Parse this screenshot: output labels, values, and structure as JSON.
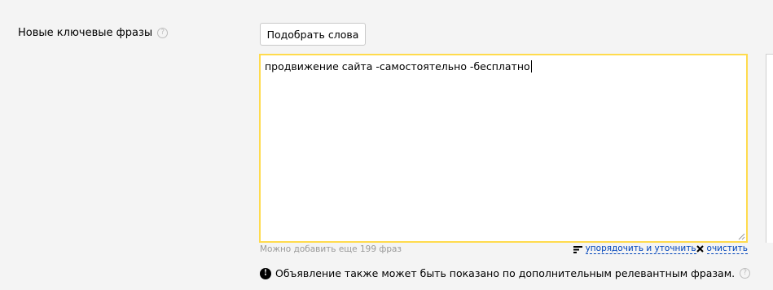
{
  "field": {
    "label": "Новые ключевые фразы",
    "help_glyph": "?"
  },
  "pick_button": {
    "label": "Подобрать слова"
  },
  "phrases": {
    "value": "продвижение сайта -самостоятельно -бесплатно"
  },
  "hint": {
    "remaining_text": "Можно добавить еще 199 фраз"
  },
  "actions": {
    "sort_label": "упорядочить и уточнить",
    "clear_label": "очистить",
    "sort_icon": "sort-lines-icon",
    "clear_icon": "close-icon"
  },
  "notice": {
    "icon_glyph": "!",
    "text": "Объявление также может быть показано по дополнительным релевантным фразам.",
    "help_glyph": "?"
  },
  "colors": {
    "focus_border": "#ffdb4d",
    "link": "#0044bb",
    "hint_text": "#999999",
    "background": "#f4f4f4"
  }
}
